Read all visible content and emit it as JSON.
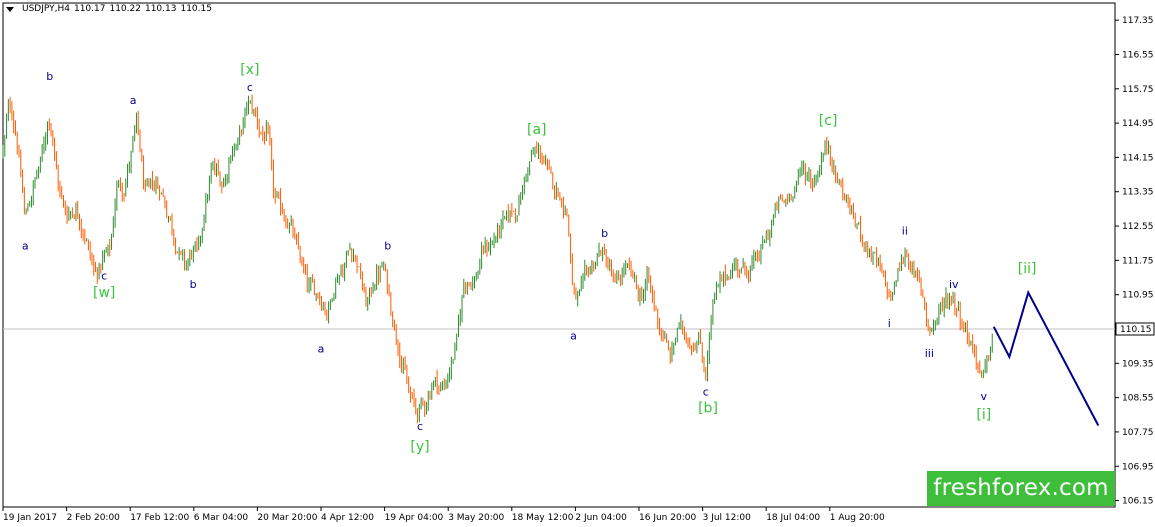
{
  "header": {
    "symbol": "USDJPY,H4",
    "open": "110.17",
    "high": "110.22",
    "low": "110.13",
    "close": "110.15"
  },
  "brand": {
    "text": "freshforex.com",
    "bg_color": "#3ebe3b"
  },
  "colors": {
    "up_candle": "#2e8b2e",
    "down_candle": "#ff5a00",
    "wave_blue": "#00008b",
    "wave_green": "#3cc33c",
    "projection": "#00008b",
    "price_line": "#c0c0c0"
  },
  "chart_data": {
    "type": "candlestick",
    "ylim": [
      106.0,
      117.75
    ],
    "y_ticks": [
      "117.35",
      "116.55",
      "115.75",
      "114.95",
      "114.15",
      "113.35",
      "112.55",
      "111.75",
      "110.95",
      "110.15",
      "109.35",
      "108.55",
      "107.75",
      "106.95",
      "106.15"
    ],
    "current_price": "110.15",
    "x_ticks": [
      "19 Jan 2017",
      "2 Feb 20:00",
      "17 Feb 12:00",
      "6 Mar 04:00",
      "20 Mar 20:00",
      "4 Apr 12:00",
      "19 Apr 04:00",
      "3 May 20:00",
      "18 May 12:00",
      "2 Jun 04:00",
      "16 Jun 20:00",
      "3 Jul 12:00",
      "18 Jul 04:00",
      "1 Aug 20:00"
    ],
    "x_range": [
      0,
      1000
    ],
    "price_path": [
      [
        0,
        114.3
      ],
      [
        5,
        115.6
      ],
      [
        12,
        114.5
      ],
      [
        19,
        112.6
      ],
      [
        26,
        113.5
      ],
      [
        33,
        114.0
      ],
      [
        41,
        115.3
      ],
      [
        48,
        113.5
      ],
      [
        56,
        112.8
      ],
      [
        65,
        113.0
      ],
      [
        74,
        112.2
      ],
      [
        82,
        111.4
      ],
      [
        90,
        111.8
      ],
      [
        96,
        112.0
      ],
      [
        102,
        113.7
      ],
      [
        108,
        113.4
      ],
      [
        116,
        114.5
      ],
      [
        120,
        115.0
      ],
      [
        127,
        113.1
      ],
      [
        134,
        113.6
      ],
      [
        141,
        113.4
      ],
      [
        149,
        112.7
      ],
      [
        156,
        112.0
      ],
      [
        163,
        111.6
      ],
      [
        170,
        112.0
      ],
      [
        175,
        111.9
      ],
      [
        180,
        113.0
      ],
      [
        188,
        114.0
      ],
      [
        197,
        113.5
      ],
      [
        204,
        114.3
      ],
      [
        212,
        114.6
      ],
      [
        220,
        115.5
      ],
      [
        227,
        115.1
      ],
      [
        234,
        114.5
      ],
      [
        238,
        114.8
      ],
      [
        242,
        113.2
      ],
      [
        250,
        112.9
      ],
      [
        258,
        112.5
      ],
      [
        266,
        111.8
      ],
      [
        274,
        111.1
      ],
      [
        283,
        111.0
      ],
      [
        291,
        110.5
      ],
      [
        299,
        111.4
      ],
      [
        307,
        111.6
      ],
      [
        311,
        112.2
      ],
      [
        318,
        111.7
      ],
      [
        326,
        110.6
      ],
      [
        334,
        111.4
      ],
      [
        342,
        111.6
      ],
      [
        348,
        110.6
      ],
      [
        356,
        109.6
      ],
      [
        364,
        108.6
      ],
      [
        372,
        108.2
      ],
      [
        380,
        108.5
      ],
      [
        387,
        109.0
      ],
      [
        395,
        108.7
      ],
      [
        402,
        109.3
      ],
      [
        408,
        110.0
      ],
      [
        414,
        111.4
      ],
      [
        423,
        111.2
      ],
      [
        431,
        112.0
      ],
      [
        440,
        112.2
      ],
      [
        448,
        112.6
      ],
      [
        456,
        112.9
      ],
      [
        463,
        113.0
      ],
      [
        470,
        113.9
      ],
      [
        477,
        114.3
      ],
      [
        484,
        114.2
      ],
      [
        490,
        113.7
      ],
      [
        497,
        113.4
      ],
      [
        503,
        113.1
      ],
      [
        507,
        112.8
      ],
      [
        512,
        110.8
      ],
      [
        516,
        110.7
      ],
      [
        523,
        111.4
      ],
      [
        530,
        111.7
      ],
      [
        537,
        112.0
      ],
      [
        544,
        111.6
      ],
      [
        551,
        111.1
      ],
      [
        558,
        111.6
      ],
      [
        565,
        111.4
      ],
      [
        572,
        110.8
      ],
      [
        579,
        111.4
      ],
      [
        586,
        110.5
      ],
      [
        594,
        109.9
      ],
      [
        600,
        109.4
      ],
      [
        606,
        110.3
      ],
      [
        613,
        110.0
      ],
      [
        620,
        109.8
      ],
      [
        626,
        109.9
      ],
      [
        631,
        108.9
      ],
      [
        637,
        110.8
      ],
      [
        644,
        111.2
      ],
      [
        650,
        111.4
      ],
      [
        658,
        111.7
      ],
      [
        666,
        111.5
      ],
      [
        673,
        111.6
      ],
      [
        681,
        112.0
      ],
      [
        688,
        112.4
      ],
      [
        696,
        113.1
      ],
      [
        704,
        113.1
      ],
      [
        712,
        113.6
      ],
      [
        720,
        113.9
      ],
      [
        728,
        113.5
      ],
      [
        736,
        114.2
      ],
      [
        742,
        114.5
      ],
      [
        747,
        113.7
      ],
      [
        754,
        113.4
      ],
      [
        761,
        112.9
      ],
      [
        768,
        112.5
      ],
      [
        775,
        112.1
      ],
      [
        782,
        111.8
      ],
      [
        789,
        111.4
      ],
      [
        797,
        110.8
      ],
      [
        804,
        111.5
      ],
      [
        811,
        112.0
      ],
      [
        818,
        111.4
      ],
      [
        825,
        111.1
      ],
      [
        832,
        110.1
      ],
      [
        840,
        110.4
      ],
      [
        847,
        110.9
      ],
      [
        853,
        110.9
      ],
      [
        861,
        110.4
      ],
      [
        868,
        109.9
      ],
      [
        876,
        109.3
      ],
      [
        881,
        108.9
      ],
      [
        886,
        109.6
      ],
      [
        891,
        110.2
      ]
    ],
    "projection": [
      [
        891,
        110.2
      ],
      [
        905,
        109.5
      ],
      [
        922,
        111.0
      ],
      [
        985,
        107.9
      ]
    ],
    "wave_labels": [
      {
        "text": "b",
        "x": 42,
        "y": 115.95,
        "color": "blue"
      },
      {
        "text": "a",
        "x": 117,
        "y": 115.4,
        "color": "blue"
      },
      {
        "text": "[x]",
        "x": 222,
        "y": 116.1,
        "color": "green"
      },
      {
        "text": "c",
        "x": 222,
        "y": 115.7,
        "color": "blue"
      },
      {
        "text": "a",
        "x": 20,
        "y": 112.0,
        "color": "blue"
      },
      {
        "text": "c",
        "x": 91,
        "y": 111.3,
        "color": "blue"
      },
      {
        "text": "[w]",
        "x": 91,
        "y": 110.9,
        "color": "green"
      },
      {
        "text": "b",
        "x": 171,
        "y": 111.1,
        "color": "blue"
      },
      {
        "text": "b",
        "x": 346,
        "y": 112.0,
        "color": "blue"
      },
      {
        "text": "a",
        "x": 286,
        "y": 109.6,
        "color": "blue"
      },
      {
        "text": "c",
        "x": 375,
        "y": 107.8,
        "color": "blue"
      },
      {
        "text": "[y]",
        "x": 375,
        "y": 107.3,
        "color": "green"
      },
      {
        "text": "[a]",
        "x": 480,
        "y": 114.7,
        "color": "green"
      },
      {
        "text": "b",
        "x": 541,
        "y": 112.3,
        "color": "blue"
      },
      {
        "text": "a",
        "x": 513,
        "y": 109.9,
        "color": "blue"
      },
      {
        "text": "c",
        "x": 632,
        "y": 108.6,
        "color": "blue"
      },
      {
        "text": "[b]",
        "x": 634,
        "y": 108.2,
        "color": "green"
      },
      {
        "text": "[c]",
        "x": 742,
        "y": 114.9,
        "color": "green"
      },
      {
        "text": "ii",
        "x": 811,
        "y": 112.35,
        "color": "blue"
      },
      {
        "text": "i",
        "x": 797,
        "y": 110.2,
        "color": "blue"
      },
      {
        "text": "iv",
        "x": 855,
        "y": 111.1,
        "color": "blue"
      },
      {
        "text": "iii",
        "x": 833,
        "y": 109.5,
        "color": "blue"
      },
      {
        "text": "v",
        "x": 882,
        "y": 108.5,
        "color": "blue"
      },
      {
        "text": "[i]",
        "x": 882,
        "y": 108.05,
        "color": "green"
      },
      {
        "text": "[ii]",
        "x": 921,
        "y": 111.45,
        "color": "green"
      }
    ]
  }
}
